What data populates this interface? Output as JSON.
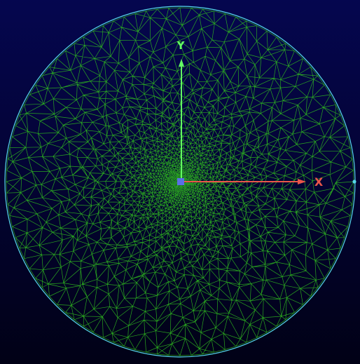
{
  "viewport": {
    "background_top": "#05064f",
    "background_bottom": "#010116"
  },
  "colors": {
    "mesh": "#2fb81f",
    "boundary": "#56d8e8",
    "y_axis": "#63ff63",
    "x_axis": "#e8564a",
    "origin": "#5a6fe6"
  },
  "axes": {
    "x_label": "X",
    "y_label": "Y"
  },
  "icons": {
    "origin_marker": "origin-marker-icon",
    "boundary_node": "boundary-node-icon"
  }
}
